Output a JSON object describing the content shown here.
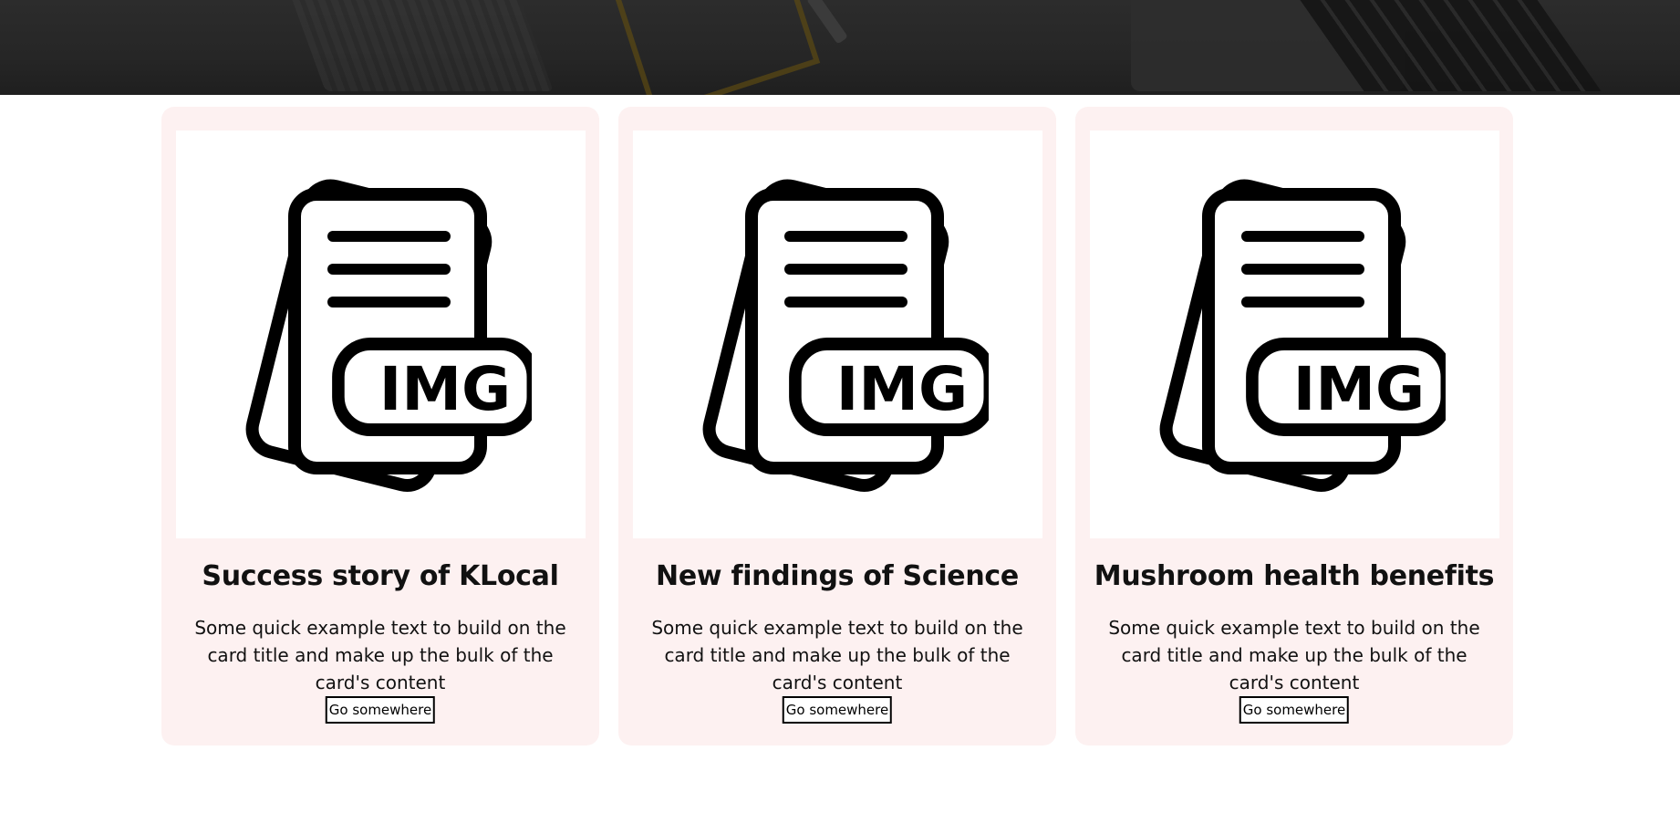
{
  "cards": [
    {
      "image_icon": "img-file-icon",
      "image_label": "IMG",
      "title": "Success story of KLocal",
      "text": "Some quick example text to build on the card title and make up the bulk of the card's content",
      "button_label": "Go somewhere"
    },
    {
      "image_icon": "img-file-icon",
      "image_label": "IMG",
      "title": "New findings of Science",
      "text": "Some quick example text to build on the card title and make up the bulk of the card's content",
      "button_label": "Go somewhere"
    },
    {
      "image_icon": "img-file-icon",
      "image_label": "IMG",
      "title": "Mushroom health benefits",
      "text": "Some quick example text to build on the card title and make up the bulk of the card's content",
      "button_label": "Go somewhere"
    }
  ],
  "colors": {
    "card_background": "#fdf1f1",
    "hero_background": "#262626",
    "text": "#111111"
  }
}
